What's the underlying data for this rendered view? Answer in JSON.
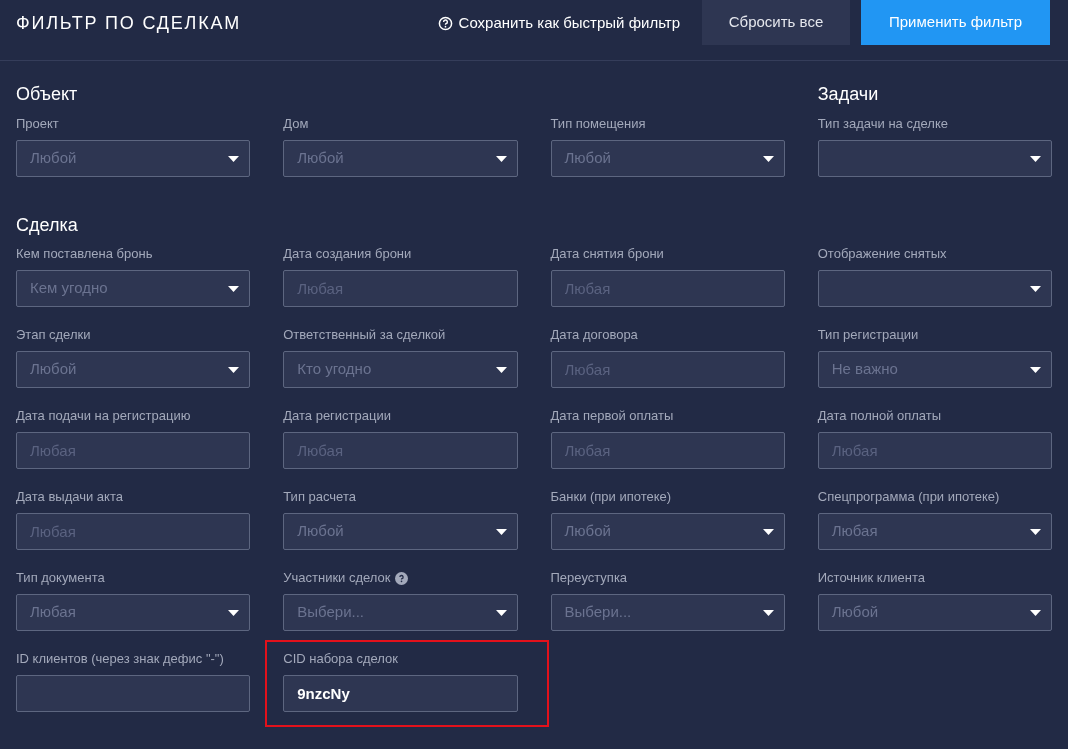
{
  "header": {
    "title": "ФИЛЬТР ПО СДЕЛКАМ",
    "save_link": "Сохранить как быстрый фильтр",
    "buttons": [
      {
        "label": "Сбросить все",
        "kind": "secondary"
      },
      {
        "label": "Применить фильтр",
        "kind": "primary"
      }
    ]
  },
  "top_sections": [
    {
      "title": "Объект",
      "fields": [
        {
          "label": "Проект",
          "kind": "select",
          "placeholder": "Любой"
        },
        {
          "label": "Дом",
          "kind": "select",
          "placeholder": "Любой"
        },
        {
          "label": "Тип помещения",
          "kind": "select",
          "placeholder": "Любой"
        }
      ]
    },
    {
      "title": "Задачи",
      "fields": [
        {
          "label": "Тип задачи на сделке",
          "kind": "select"
        }
      ]
    }
  ],
  "deal_section": {
    "title": "Сделка",
    "fields": [
      {
        "label": "Кем поставлена бронь",
        "kind": "select",
        "placeholder": "Кем угодно"
      },
      {
        "label": "Дата создания брони",
        "kind": "input",
        "placeholder": "Любая"
      },
      {
        "label": "Дата снятия брони",
        "kind": "input",
        "placeholder": "Любая"
      },
      {
        "label": "Отображение снятых",
        "kind": "select"
      },
      {
        "label": "Этап сделки",
        "kind": "select",
        "placeholder": "Любой"
      },
      {
        "label": "Ответственный за сделкой",
        "kind": "select",
        "placeholder": "Кто угодно"
      },
      {
        "label": "Дата договора",
        "kind": "input",
        "placeholder": "Любая"
      },
      {
        "label": "Тип регистрации",
        "kind": "select",
        "placeholder": "Не важно"
      },
      {
        "label": "Дата подачи на регистрацию",
        "kind": "input",
        "placeholder": "Любая"
      },
      {
        "label": "Дата регистрации",
        "kind": "input",
        "placeholder": "Любая"
      },
      {
        "label": "Дата первой оплаты",
        "kind": "input",
        "placeholder": "Любая"
      },
      {
        "label": "Дата полной оплаты",
        "kind": "input",
        "placeholder": "Любая"
      },
      {
        "label": "Дата выдачи акта",
        "kind": "input",
        "placeholder": "Любая"
      },
      {
        "label": "Тип расчета",
        "kind": "select",
        "placeholder": "Любой"
      },
      {
        "label": "Банки (при ипотеке)",
        "kind": "select",
        "placeholder": "Любой"
      },
      {
        "label": "Спецпрограмма (при ипотеке)",
        "kind": "select",
        "placeholder": "Любая"
      },
      {
        "label": "Тип документа",
        "kind": "select",
        "placeholder": "Любая"
      },
      {
        "label": "Участники сделок",
        "kind": "select",
        "placeholder": "Выбери...",
        "help": true
      },
      {
        "label": "Переуступка",
        "kind": "select",
        "placeholder": "Выбери..."
      },
      {
        "label": "Источник клиента",
        "kind": "select",
        "placeholder": "Любой"
      },
      {
        "label": "ID клиентов (через знак дефис \"-\")",
        "kind": "input"
      },
      {
        "label": "CID набора сделок",
        "kind": "input",
        "value": "9nzcNy",
        "highlighted": true
      }
    ]
  }
}
